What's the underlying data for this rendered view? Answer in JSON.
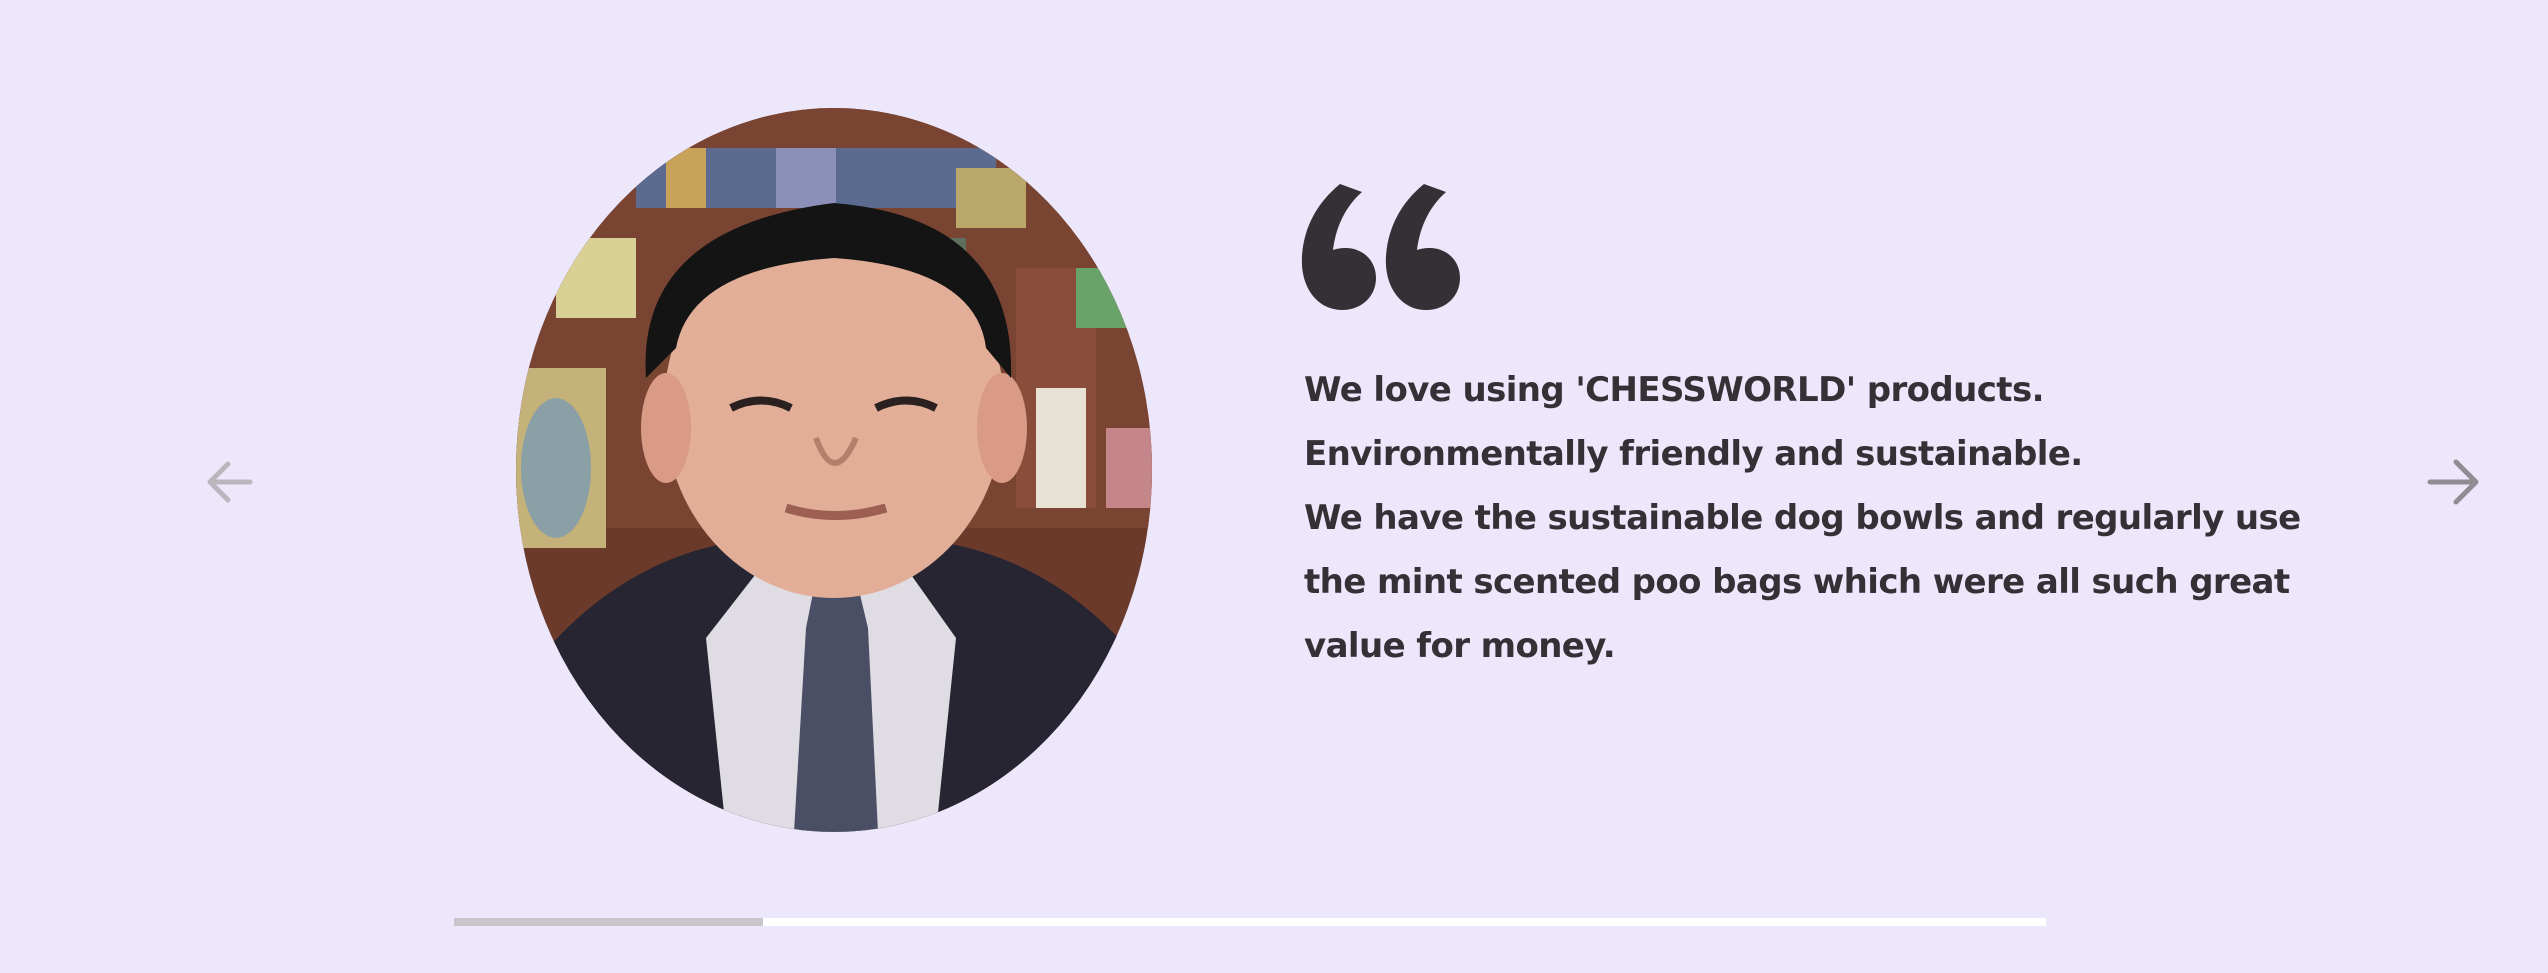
{
  "testimonial": {
    "quote_lines": [
      "We love using 'CHESSWORLD' products.",
      "Environmentally friendly and sustainable.",
      "We have the sustainable dog bowls and regularly use",
      "the mint scented poo bags which were all such great",
      "value for money."
    ],
    "quote_mark": "“",
    "portrait_alt": "portrait"
  },
  "navigation": {
    "prev_icon": "arrow-left-icon",
    "next_icon": "arrow-right-icon",
    "prev_color": "#b9b7bd",
    "next_color": "#8f8d93"
  },
  "progress": {
    "fraction": 0.194,
    "track_color": "#ffffff",
    "fill_color": "#c8c6cb"
  },
  "colors": {
    "background": "#ede7fb",
    "text": "#333036"
  }
}
